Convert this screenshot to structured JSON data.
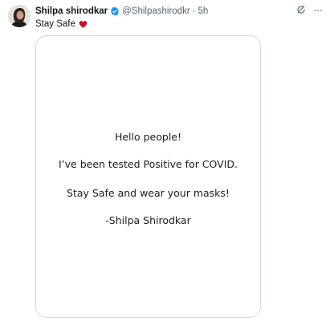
{
  "tweet": {
    "author": {
      "display_name": "Shilpa shirodkar",
      "handle": "@Shilpashirodkr",
      "verified": true
    },
    "time": "5h",
    "separator": "·",
    "text": "Stay Safe",
    "emoji": "heart-icon"
  },
  "media": {
    "lines": [
      "Hello people!",
      "I’ve been tested Positive for COVID.",
      "Stay Safe and wear your masks!",
      "-Shilpa Shirodkar"
    ]
  },
  "colors": {
    "verified_badge": "#1d9bf0",
    "heart": "#c8102e",
    "secondary_text": "#536471",
    "border": "#cfd9de"
  },
  "actions": {
    "more_label": "···"
  }
}
